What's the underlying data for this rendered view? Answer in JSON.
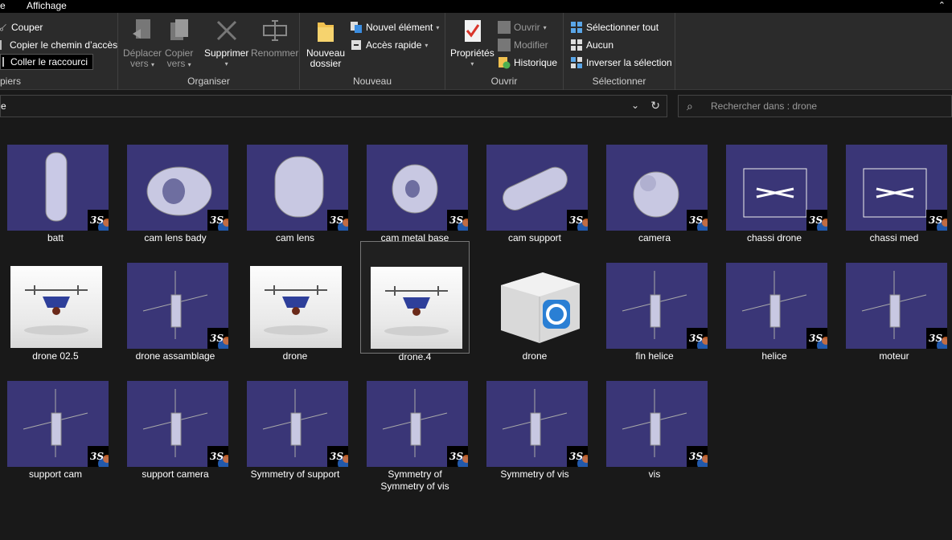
{
  "tabs": [
    {
      "label": "e"
    },
    {
      "label": "Affichage"
    }
  ],
  "ribbon": {
    "clipboard": {
      "cut": "Couper",
      "copy_path": "Copier le chemin d’accès",
      "paste_shortcut": "Coller le raccourci",
      "group": "piers"
    },
    "organize": {
      "move_line1": "Déplacer",
      "move_line2": "vers",
      "copy_line1": "Copier",
      "copy_line2": "vers",
      "delete": "Supprimer",
      "rename": "Renommer",
      "group": "Organiser"
    },
    "new": {
      "folder_line1": "Nouveau",
      "folder_line2": "dossier",
      "new_item": "Nouvel élément",
      "quick_access": "Accès rapide",
      "group": "Nouveau"
    },
    "open": {
      "properties": "Propriétés",
      "open": "Ouvrir",
      "edit": "Modifier",
      "history": "Historique",
      "group": "Ouvrir"
    },
    "select": {
      "select_all": "Sélectionner tout",
      "none": "Aucun",
      "invert": "Inverser la sélection",
      "group": "Sélectionner"
    }
  },
  "address": {
    "path": "e",
    "search_placeholder": "Rechercher dans : drone"
  },
  "files": [
    {
      "name": "batt",
      "kind": "catia"
    },
    {
      "name": "cam lens bady",
      "kind": "catia"
    },
    {
      "name": "cam lens",
      "kind": "catia"
    },
    {
      "name": "cam metal base",
      "kind": "catia"
    },
    {
      "name": "cam support",
      "kind": "catia"
    },
    {
      "name": "camera",
      "kind": "catia"
    },
    {
      "name": "chassi drone",
      "kind": "catia"
    },
    {
      "name": "chassi med",
      "kind": "catia"
    },
    {
      "name": "drone 02.5",
      "kind": "photo"
    },
    {
      "name": "drone assamblage",
      "kind": "catia"
    },
    {
      "name": "drone",
      "kind": "photo"
    },
    {
      "name": "drone.4",
      "kind": "photo",
      "selected": true
    },
    {
      "name": "drone",
      "kind": "keyshot"
    },
    {
      "name": "fin helice",
      "kind": "catia"
    },
    {
      "name": "helice",
      "kind": "catia"
    },
    {
      "name": "moteur",
      "kind": "catia"
    },
    {
      "name": "support cam",
      "kind": "catia"
    },
    {
      "name": "support camera",
      "kind": "catia"
    },
    {
      "name": "Symmetry of support",
      "kind": "catia"
    },
    {
      "name": "Symmetry of\nSymmetry of vis",
      "kind": "catia"
    },
    {
      "name": "Symmetry of vis",
      "kind": "catia"
    },
    {
      "name": "vis",
      "kind": "catia"
    }
  ],
  "colors": {
    "thumb_bg": "#3a3677",
    "window_bg": "#191919",
    "ribbon_bg": "#2b2b2b"
  }
}
